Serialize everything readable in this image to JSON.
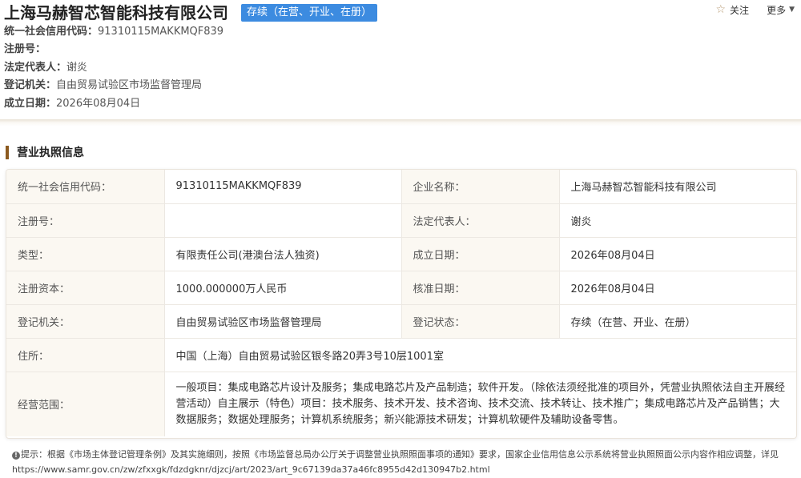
{
  "header": {
    "company_name": "上海马赫智芯智能科技有限公司",
    "status": "存续（在营、开业、在册）",
    "follow_label": "关注",
    "more_label": "更多",
    "info": [
      {
        "label": "统一社会信用代码：",
        "value": "91310115MAKKMQF839"
      },
      {
        "label": "注册号：",
        "value": ""
      },
      {
        "label": "法定代表人：",
        "value": "谢炎"
      },
      {
        "label": "登记机关：",
        "value": "自由贸易试验区市场监督管理局"
      },
      {
        "label": "成立日期：",
        "value": "2026年08月04日"
      }
    ]
  },
  "section": {
    "title": "营业执照信息"
  },
  "table": {
    "credit_code_label": "统一社会信用代码：",
    "credit_code": "91310115MAKKMQF839",
    "company_name_label": "企业名称：",
    "company_name": "上海马赫智芯智能科技有限公司",
    "reg_no_label": "注册号：",
    "reg_no": "",
    "legal_rep_label": "法定代表人：",
    "legal_rep": "谢炎",
    "type_label": "类型：",
    "type": "有限责任公司(港澳台法人独资)",
    "found_date_label": "成立日期：",
    "found_date": "2026年08月04日",
    "capital_label": "注册资本：",
    "capital": "1000.000000万人民币",
    "approve_date_label": "核准日期：",
    "approve_date": "2026年08月04日",
    "authority_label": "登记机关：",
    "authority": "自由贸易试验区市场监督管理局",
    "reg_status_label": "登记状态：",
    "reg_status": "存续（在营、开业、在册）",
    "address_label": "住所：",
    "address": "中国（上海）自由贸易试验区银冬路20弄3号10层1001室",
    "scope_label": "经营范围：",
    "scope": "一般项目：集成电路芯片设计及服务；集成电路芯片及产品制造；软件开发。（除依法须经批准的项目外，凭营业执照依法自主开展经营活动）自主展示（特色）项目：技术服务、技术开发、技术咨询、技术交流、技术转让、技术推广；集成电路芯片及产品销售；大数据服务；数据处理服务；计算机系统服务；新兴能源技术研发；计算机软硬件及辅助设备零售。"
  },
  "notice": {
    "text": "提示：根据《市场主体登记管理条例》及其实施细则，按照《市场监督总局办公厅关于调整营业执照照面事项的通知》要求，国家企业信用信息公示系统将营业执照照面公示内容作相应调整，详见",
    "url": "https://www.samr.gov.cn/zw/zfxxgk/fdzdgknr/djzcj/art/2023/art_9c67139da37a46fc8955d42d130947b2.html"
  },
  "colors": {
    "status_badge": "#3c8be0",
    "section_accent": "#8c5a1f",
    "label_cell_bg": "#fbf8f2"
  }
}
